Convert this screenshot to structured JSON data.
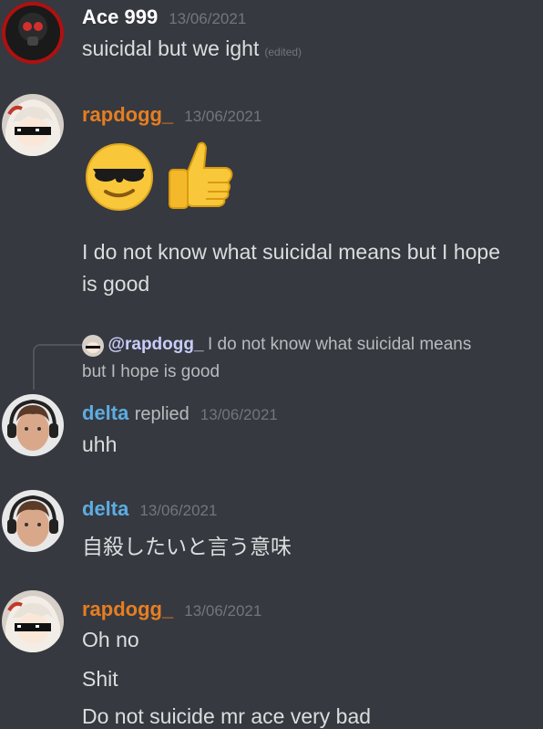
{
  "messages": {
    "ace": {
      "author": "Ace 999",
      "author_color": "#ffffff",
      "timestamp": "13/06/2021",
      "text": "suicidal but we ight",
      "edited": "(edited)"
    },
    "rapdogg1": {
      "author": "rapdogg_",
      "author_color": "#e67e22",
      "timestamp": "13/06/2021",
      "emojis": [
        "sunglasses-emoji",
        "thumbs-up-emoji"
      ],
      "line1": "I do not know what suicidal means but I hope",
      "line2": "is good"
    },
    "reply_preview": {
      "mention": "@rapdogg_",
      "text1": "I do not know what suicidal means",
      "text2": "but I hope is good"
    },
    "delta1": {
      "author": "delta",
      "author_color": "#5dade2",
      "replied": "replied",
      "timestamp": "13/06/2021",
      "text": "uhh"
    },
    "delta2": {
      "author": "delta",
      "author_color": "#5dade2",
      "timestamp": "13/06/2021",
      "text": "自殺したいと言う意味"
    },
    "rapdogg2": {
      "author": "rapdogg_",
      "author_color": "#e67e22",
      "timestamp": "13/06/2021",
      "line1": "Oh no",
      "line2": "Shit",
      "line3": "Do not suicide mr ace very bad"
    }
  },
  "colors": {
    "background": "#36393f",
    "timestamp": "#72767d",
    "text": "#dcddde"
  }
}
